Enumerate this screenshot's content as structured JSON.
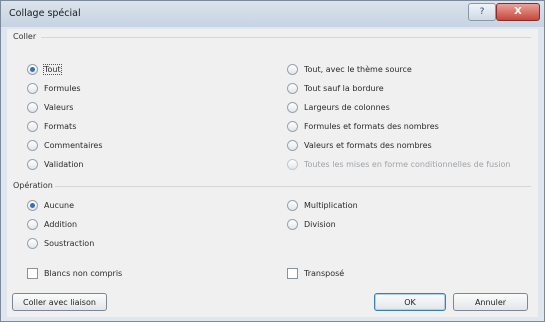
{
  "window": {
    "title": "Collage spécial",
    "help_label": "?",
    "close_label": "X"
  },
  "coller": {
    "label": "Coller",
    "left_options": [
      {
        "label": "Tout",
        "checked": true
      },
      {
        "label": "Formules",
        "checked": false
      },
      {
        "label": "Valeurs",
        "checked": false
      },
      {
        "label": "Formats",
        "checked": false
      },
      {
        "label": "Commentaires",
        "checked": false
      },
      {
        "label": "Validation",
        "checked": false
      }
    ],
    "right_options": [
      {
        "label": "Tout, avec le thème source",
        "checked": false
      },
      {
        "label": "Tout sauf la bordure",
        "checked": false
      },
      {
        "label": "Largeurs de colonnes",
        "checked": false
      },
      {
        "label": "Formules et formats des nombres",
        "checked": false
      },
      {
        "label": "Valeurs et formats des nombres",
        "checked": false
      },
      {
        "label": "Toutes les mises en forme conditionnelles de fusion",
        "checked": false,
        "disabled": true
      }
    ]
  },
  "operation": {
    "label": "Opération",
    "left_options": [
      {
        "label": "Aucune",
        "checked": true
      },
      {
        "label": "Addition",
        "checked": false
      },
      {
        "label": "Soustraction",
        "checked": false
      }
    ],
    "right_options": [
      {
        "label": "Multiplication",
        "checked": false
      },
      {
        "label": "Division",
        "checked": false
      }
    ]
  },
  "checkboxes": {
    "skip_blanks": "Blancs non compris",
    "transpose": "Transposé"
  },
  "buttons": {
    "paste_link": "Coller avec liaison",
    "ok": "OK",
    "cancel": "Annuler"
  }
}
